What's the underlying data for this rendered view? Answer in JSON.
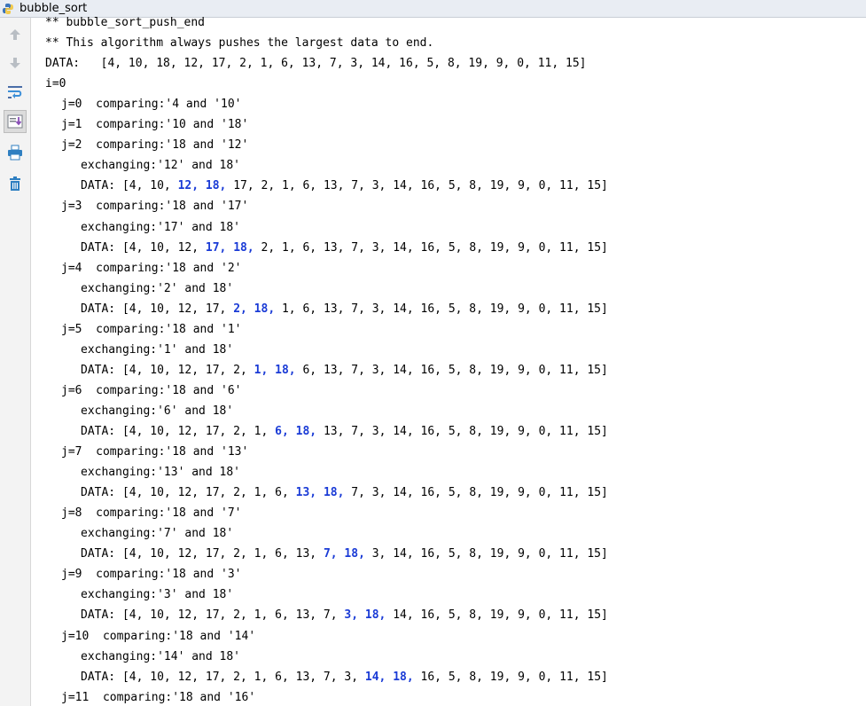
{
  "window": {
    "title": "bubble_sort"
  },
  "toolbar": {
    "icons": [
      "up-arrow-icon",
      "down-arrow-icon",
      "soft-wrap-icon",
      "scroll-to-end-icon",
      "print-icon",
      "trash-icon"
    ]
  },
  "console": {
    "highlight_color": "#1a3bd6",
    "lines": [
      {
        "indent": 0,
        "segments": [
          {
            "t": "** bubble_sort_push_end"
          }
        ]
      },
      {
        "indent": 0,
        "segments": [
          {
            "t": "** This algorithm always pushes the largest data to end."
          }
        ]
      },
      {
        "indent": 0,
        "segments": [
          {
            "t": "DATA:   [4, 10, 18, 12, 17, 2, 1, 6, 13, 7, 3, 14, 16, 5, 8, 19, 9, 0, 11, 15]"
          }
        ]
      },
      {
        "indent": 0,
        "segments": [
          {
            "t": "i=0"
          }
        ]
      },
      {
        "indent": 18,
        "segments": [
          {
            "t": "j=0  comparing:'4 and '10'"
          }
        ]
      },
      {
        "indent": 18,
        "segments": [
          {
            "t": "j=1  comparing:'10 and '18'"
          }
        ]
      },
      {
        "indent": 18,
        "segments": [
          {
            "t": "j=2  comparing:'18 and '12'"
          }
        ]
      },
      {
        "indent": 40,
        "segments": [
          {
            "t": "exchanging:'12' and 18'"
          }
        ]
      },
      {
        "indent": 40,
        "segments": [
          {
            "t": "DATA: [4, 10, "
          },
          {
            "t": "12, 18,",
            "h": true
          },
          {
            "t": " 17, 2, 1, 6, 13, 7, 3, 14, 16, 5, 8, 19, 9, 0, 11, 15]"
          }
        ]
      },
      {
        "indent": 18,
        "segments": [
          {
            "t": "j=3  comparing:'18 and '17'"
          }
        ]
      },
      {
        "indent": 40,
        "segments": [
          {
            "t": "exchanging:'17' and 18'"
          }
        ]
      },
      {
        "indent": 40,
        "segments": [
          {
            "t": "DATA: [4, 10, 12, "
          },
          {
            "t": "17, 18,",
            "h": true
          },
          {
            "t": " 2, 1, 6, 13, 7, 3, 14, 16, 5, 8, 19, 9, 0, 11, 15]"
          }
        ]
      },
      {
        "indent": 18,
        "segments": [
          {
            "t": "j=4  comparing:'18 and '2'"
          }
        ]
      },
      {
        "indent": 40,
        "segments": [
          {
            "t": "exchanging:'2' and 18'"
          }
        ]
      },
      {
        "indent": 40,
        "segments": [
          {
            "t": "DATA: [4, 10, 12, 17, "
          },
          {
            "t": "2, 18,",
            "h": true
          },
          {
            "t": " 1, 6, 13, 7, 3, 14, 16, 5, 8, 19, 9, 0, 11, 15]"
          }
        ]
      },
      {
        "indent": 18,
        "segments": [
          {
            "t": "j=5  comparing:'18 and '1'"
          }
        ]
      },
      {
        "indent": 40,
        "segments": [
          {
            "t": "exchanging:'1' and 18'"
          }
        ]
      },
      {
        "indent": 40,
        "segments": [
          {
            "t": "DATA: [4, 10, 12, 17, 2, "
          },
          {
            "t": "1, 18,",
            "h": true
          },
          {
            "t": " 6, 13, 7, 3, 14, 16, 5, 8, 19, 9, 0, 11, 15]"
          }
        ]
      },
      {
        "indent": 18,
        "segments": [
          {
            "t": "j=6  comparing:'18 and '6'"
          }
        ]
      },
      {
        "indent": 40,
        "segments": [
          {
            "t": "exchanging:'6' and 18'"
          }
        ]
      },
      {
        "indent": 40,
        "segments": [
          {
            "t": "DATA: [4, 10, 12, 17, 2, 1, "
          },
          {
            "t": "6, 18,",
            "h": true
          },
          {
            "t": " 13, 7, 3, 14, 16, 5, 8, 19, 9, 0, 11, 15]"
          }
        ]
      },
      {
        "indent": 18,
        "segments": [
          {
            "t": "j=7  comparing:'18 and '13'"
          }
        ]
      },
      {
        "indent": 40,
        "segments": [
          {
            "t": "exchanging:'13' and 18'"
          }
        ]
      },
      {
        "indent": 40,
        "segments": [
          {
            "t": "DATA: [4, 10, 12, 17, 2, 1, 6, "
          },
          {
            "t": "13, 18,",
            "h": true
          },
          {
            "t": " 7, 3, 14, 16, 5, 8, 19, 9, 0, 11, 15]"
          }
        ]
      },
      {
        "indent": 18,
        "segments": [
          {
            "t": "j=8  comparing:'18 and '7'"
          }
        ]
      },
      {
        "indent": 40,
        "segments": [
          {
            "t": "exchanging:'7' and 18'"
          }
        ]
      },
      {
        "indent": 40,
        "segments": [
          {
            "t": "DATA: [4, 10, 12, 17, 2, 1, 6, 13, "
          },
          {
            "t": "7, 18,",
            "h": true
          },
          {
            "t": " 3, 14, 16, 5, 8, 19, 9, 0, 11, 15]"
          }
        ]
      },
      {
        "indent": 18,
        "segments": [
          {
            "t": "j=9  comparing:'18 and '3'"
          }
        ]
      },
      {
        "indent": 40,
        "segments": [
          {
            "t": "exchanging:'3' and 18'"
          }
        ]
      },
      {
        "indent": 40,
        "segments": [
          {
            "t": "DATA: [4, 10, 12, 17, 2, 1, 6, 13, 7, "
          },
          {
            "t": "3, 18,",
            "h": true
          },
          {
            "t": " 14, 16, 5, 8, 19, 9, 0, 11, 15]"
          }
        ]
      },
      {
        "indent": 18,
        "segments": [
          {
            "t": "j=10  comparing:'18 and '14'"
          }
        ]
      },
      {
        "indent": 40,
        "segments": [
          {
            "t": "exchanging:'14' and 18'"
          }
        ]
      },
      {
        "indent": 40,
        "segments": [
          {
            "t": "DATA: [4, 10, 12, 17, 2, 1, 6, 13, 7, 3, "
          },
          {
            "t": "14, 18,",
            "h": true
          },
          {
            "t": " 16, 5, 8, 19, 9, 0, 11, 15]"
          }
        ]
      },
      {
        "indent": 18,
        "segments": [
          {
            "t": "j=11  comparing:'18 and '16'"
          }
        ]
      }
    ]
  }
}
